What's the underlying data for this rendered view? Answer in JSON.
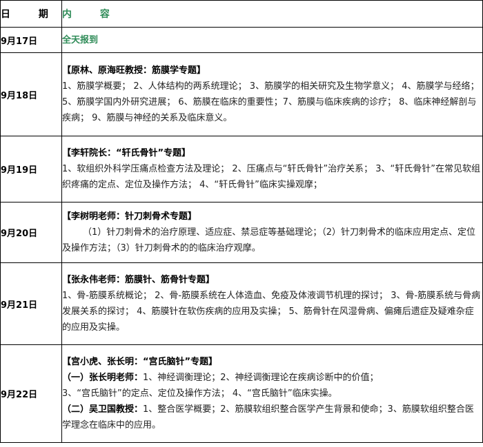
{
  "header": {
    "date": "日 期",
    "content": "内 容"
  },
  "rows": [
    {
      "date": "9月17日",
      "title": "全天报到"
    },
    {
      "date": "9月18日",
      "title": "【原林、原海旺教授：筋膜学专题】",
      "body": "1、筋膜学概要； 2、人体结构的两系统理论； 3、筋膜学的相关研究及生物学意义； 4、筋膜学与经络； 5、筋膜学国内外研究进展； 6、筋膜在临床的重要性；7、筋膜与临床疾病的诊疗； 8、临床神经解剖与疾病； 9、筋膜与神经的关系及临床意义。"
    },
    {
      "date": "9月19日",
      "title": "【李轩院长：“轩氏骨针”专题】",
      "body": "1、软组织外科学压痛点检查方法及理论； 2、压痛点与“轩氏骨针”治疗关系； 3、“轩氏骨针”在常见软组织疼痛的定点、定位及操作方法； 4、“轩氏骨针”临床实操观摩；"
    },
    {
      "date": "9月20日",
      "title": "【李树明老师：针刀刺骨术专题】",
      "body": "（1）针刀刺骨术的治疗原理、适应症、禁忌症等基础理论；（2）针刀刺骨术的临床应用定点、定位及操作方法；（3）针刀刺骨术的的临床治疗观摩。"
    },
    {
      "date": "9月21日",
      "title": "【张永伟老师：筋膜针、筋骨针专题】",
      "body": "1、骨-筋膜系统概论； 2、骨-筋膜系统在人体造血、免疫及体液调节机理的探讨； 3、骨-筋膜系统与骨病发展关系的探讨； 4、筋膜针在软伤疾病的应用及实操； 5、筋骨针在风湿骨病、偏瘫后遗症及疑难杂症的应用及实操。"
    },
    {
      "date": "9月22日",
      "title": "【宫小虎、张长明：“宫氏脑针”专题】",
      "sub1_title": "（一）张长明老师：",
      "sub1_body": "1、神经调衡理论；2、神经调衡理论在疾病诊断中的价值；",
      "sub1_body2": "3、“宫氏脑针”的定点、定位及操作方法； 4、“宫氏脑针”临床实操。",
      "sub2_title": "（二）吴卫国教授：",
      "sub2_body": "1、整合医学概要；2、筋膜软组织整合医学产生背景和使命；3、筋膜软组织整合医学理念在临床中的应用。"
    }
  ]
}
